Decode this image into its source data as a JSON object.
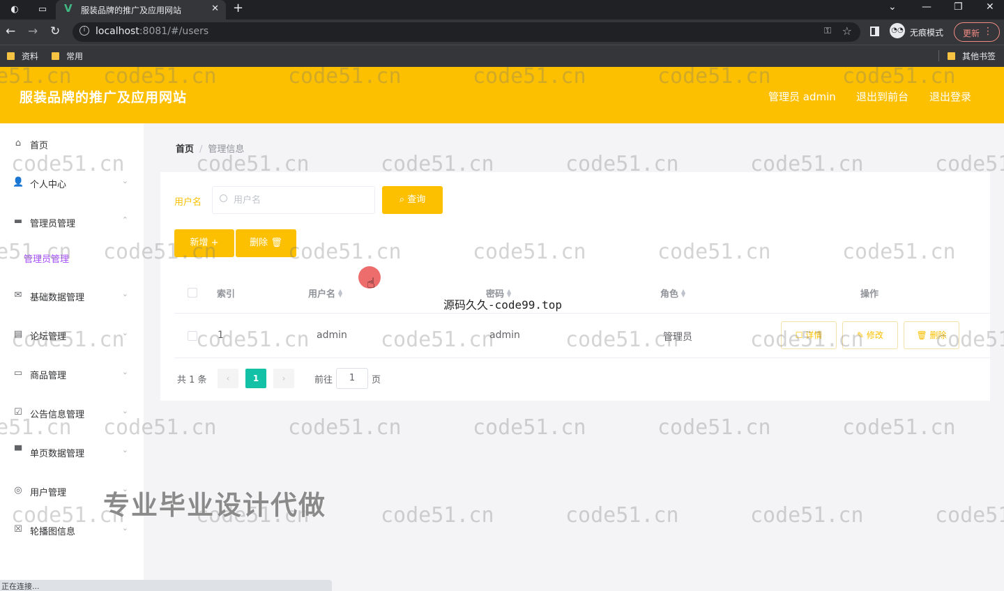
{
  "browser": {
    "tab_title": "服装品牌的推广及应用网站",
    "tab_favicon": "V",
    "url_host": "localhost",
    "url_rest": ":8081/#/users",
    "incognito_label": "无痕模式",
    "update_label": "更新",
    "bookmarks": [
      "资料",
      "常用"
    ],
    "other_bookmarks": "其他书签",
    "status_text": "正在连接..."
  },
  "header": {
    "title": "服装品牌的推广及应用网站",
    "user_label": "管理员 admin",
    "front_link": "退出到前台",
    "logout_link": "退出登录",
    "color": "#fcc000"
  },
  "sidebar": {
    "items": [
      {
        "label": "首页",
        "icon": "home-icon"
      },
      {
        "label": "个人中心",
        "icon": "user-icon"
      },
      {
        "label": "管理员管理",
        "icon": "admin-icon"
      },
      {
        "label": "基础数据管理",
        "icon": "mail-icon"
      },
      {
        "label": "论坛管理",
        "icon": "doc-icon"
      },
      {
        "label": "商品管理",
        "icon": "chat-icon"
      },
      {
        "label": "公告信息管理",
        "icon": "check-icon"
      },
      {
        "label": "单页数据管理",
        "icon": "monitor-icon"
      },
      {
        "label": "用户管理",
        "icon": "globe-icon"
      },
      {
        "label": "轮播图信息",
        "icon": "image-icon"
      }
    ],
    "active_sub": "管理员管理",
    "active_color": "#a64dff"
  },
  "breadcrumb": {
    "home": "首页",
    "sep": "/",
    "current": "管理信息"
  },
  "search": {
    "label": "用户名",
    "placeholder": "用户名",
    "value": "",
    "button": "查询"
  },
  "actions": {
    "add": "新增",
    "delete": "删除"
  },
  "table": {
    "columns": [
      "索引",
      "用户名",
      "密码",
      "角色",
      "操作"
    ],
    "rows": [
      {
        "index": "1",
        "username": "admin",
        "password": "admin",
        "role": "管理员"
      }
    ],
    "row_ops": [
      "详情",
      "修改",
      "删除"
    ]
  },
  "pagination": {
    "total": "共 1 条",
    "prev": "‹",
    "current": "1",
    "next": "›",
    "goto_label": "前往",
    "goto_value": "1",
    "unit": "页"
  },
  "overlays": {
    "watermark": "code51.cn",
    "code99": "源码久久-code99.top",
    "ad": "专业毕业设计代做"
  }
}
